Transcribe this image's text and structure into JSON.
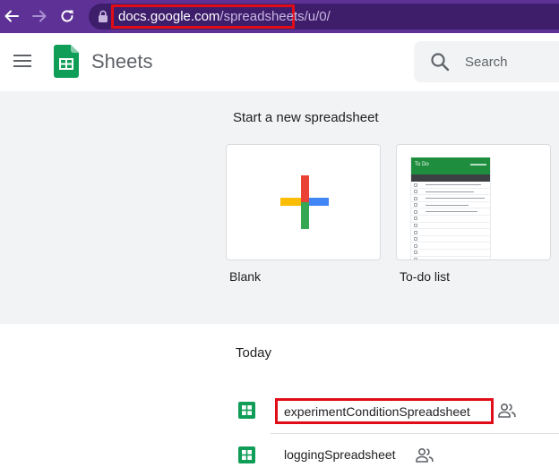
{
  "browser": {
    "url_host": "docs.google.com",
    "url_path": "/spreadsheets/u/0/",
    "icons": {
      "back": "arrow-left-icon",
      "forward": "arrow-right-icon",
      "reload": "reload-icon",
      "lock": "lock-icon"
    },
    "colors": {
      "chrome_bg": "#5d3196",
      "omnibox_bg": "#3e1d6b",
      "highlight": "#e00d18"
    }
  },
  "header": {
    "app_name": "Sheets",
    "search_placeholder": "Search",
    "icons": {
      "menu": "hamburger-menu-icon",
      "logo": "sheets-logo-icon",
      "search": "search-icon"
    },
    "colors": {
      "logo_green": "#0f9d58"
    }
  },
  "templates": {
    "heading": "Start a new spreadsheet",
    "items": [
      {
        "label": "Blank",
        "icon": "plus-icon"
      },
      {
        "label": "To-do list",
        "thumbnail_title": "To Do"
      }
    ],
    "colors": {
      "section_bg": "#f1f3f4"
    }
  },
  "recent": {
    "heading": "Today",
    "documents": [
      {
        "name": "experimentConditionSpreadsheet",
        "shared": true,
        "icon": "sheets-file-icon"
      },
      {
        "name": "loggingSpreadsheet",
        "shared": true,
        "icon": "sheets-file-icon"
      }
    ]
  }
}
